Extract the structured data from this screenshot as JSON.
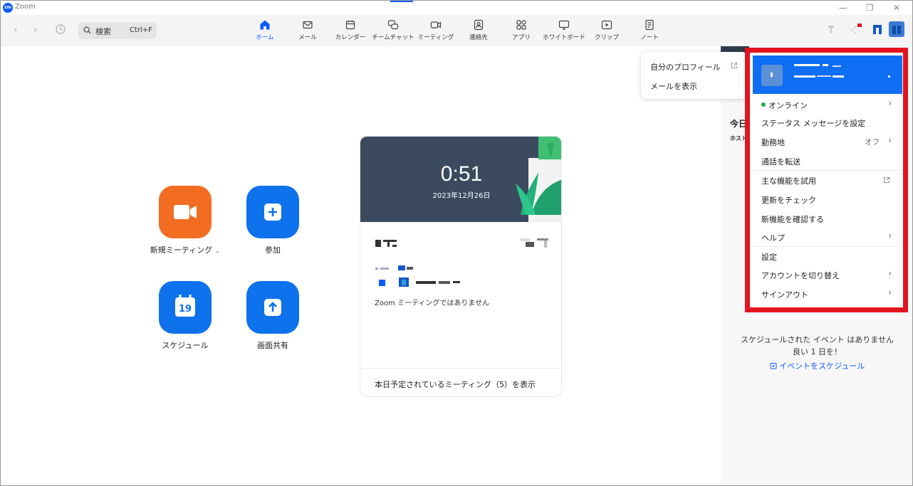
{
  "window": {
    "title": "Zoom",
    "logo_text": "zm"
  },
  "toolbar": {
    "search_label": "検索",
    "search_shortcut": "Ctrl+F",
    "tabs": [
      {
        "label": "ホーム",
        "icon": "home-icon"
      },
      {
        "label": "メール",
        "icon": "mail-icon"
      },
      {
        "label": "カレンダー",
        "icon": "calendar-icon"
      },
      {
        "label": "チームチャット",
        "icon": "chat-icon"
      },
      {
        "label": "ミーティング",
        "icon": "video-icon"
      },
      {
        "label": "連絡先",
        "icon": "contacts-icon"
      },
      {
        "label": "アプリ",
        "icon": "apps-icon"
      },
      {
        "label": "ホワイトボード",
        "icon": "whiteboard-icon"
      },
      {
        "label": "クリップ",
        "icon": "clips-icon"
      },
      {
        "label": "ノート",
        "icon": "notes-icon"
      }
    ]
  },
  "actions": {
    "new_meeting": "新規ミーティング",
    "join": "参加",
    "schedule": "スケジュール",
    "schedule_day": "19",
    "share_screen": "画面共有"
  },
  "card": {
    "time": "0:51",
    "date": "2023年12月26日",
    "no_meeting": "Zoom ミーティングではありません",
    "footer": "本日予定されているミーティング（5）を表示"
  },
  "right_panel": {
    "today": "今日",
    "host": "ホスト",
    "empty_line1": "スケジュールされた イベント はありません",
    "empty_line2": "良い 1 日を！",
    "schedule_event": "イベントをスケジュール"
  },
  "popover": {
    "my_profile": "自分のプロフィール",
    "show_mail": "メールを表示"
  },
  "menu": {
    "online": "オンライン",
    "status_message": "ステータス メッセージを設定",
    "work_location": "勤務地",
    "work_location_value": "オフ",
    "forward_calls": "通話を転送",
    "try_features": "主な機能を試用",
    "check_updates": "更新をチェック",
    "whats_new": "新機能を確認する",
    "help": "ヘルプ",
    "settings": "設定",
    "switch_account": "アカウントを切り替え",
    "sign_out": "サインアウト"
  },
  "colors": {
    "accent": "#0b5cff",
    "orange": "#f26d21",
    "highlight": "#e3141f",
    "online": "#1fae3f"
  }
}
